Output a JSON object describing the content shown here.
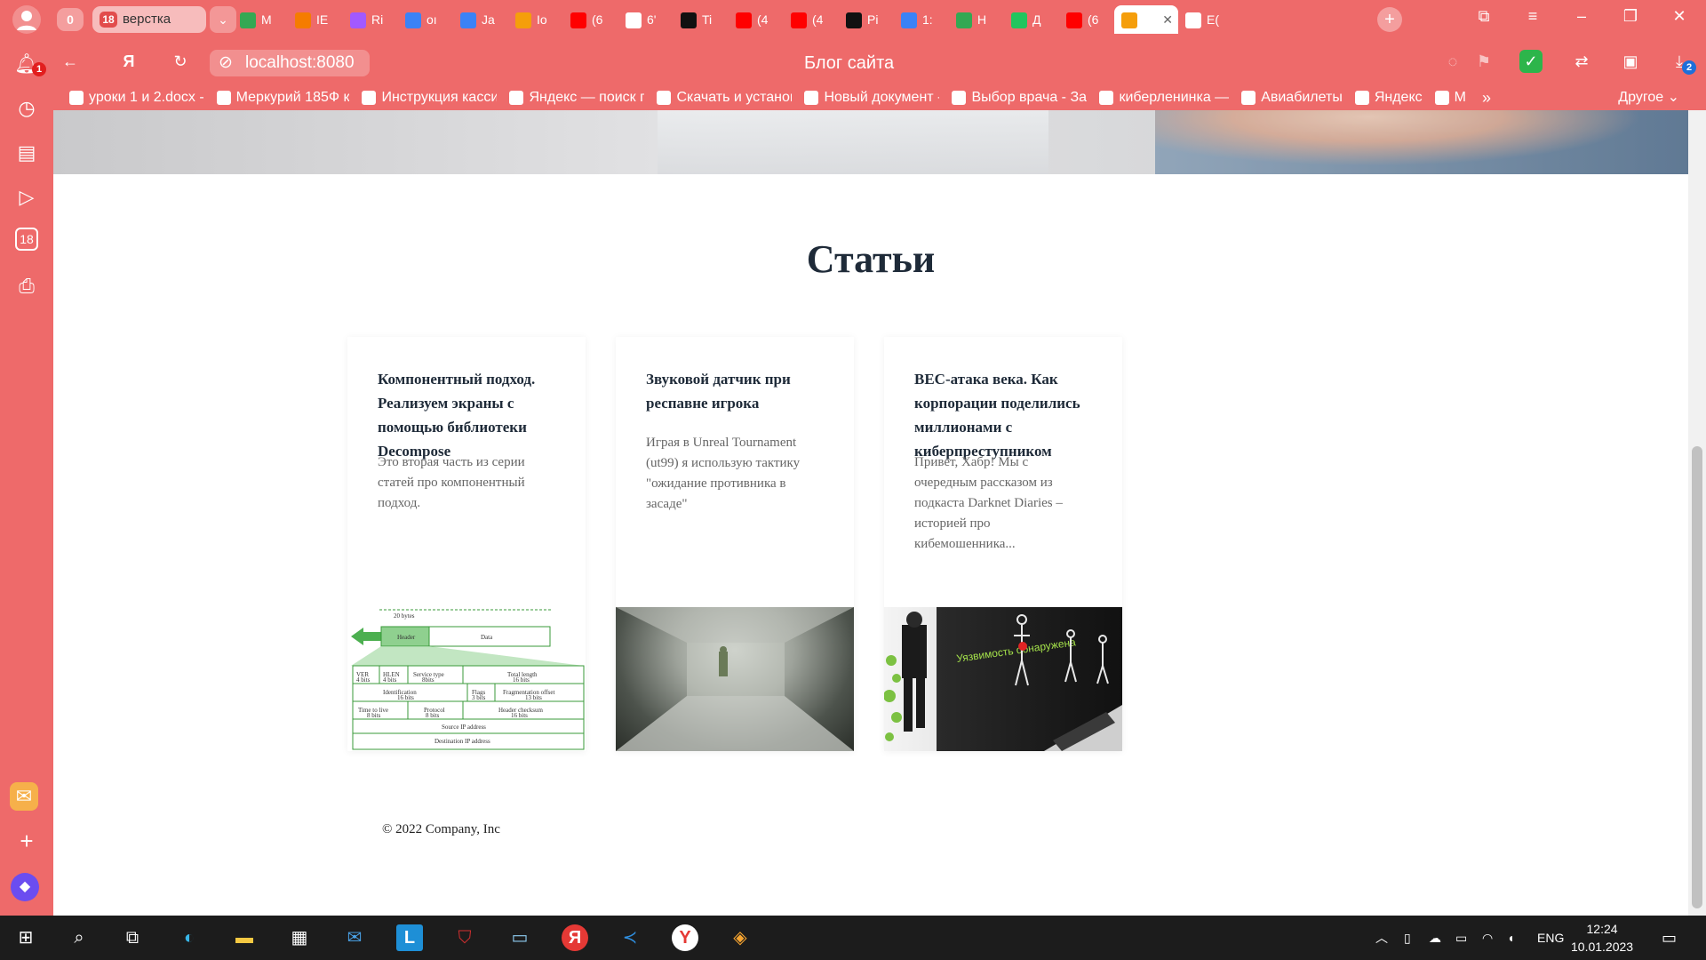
{
  "browser": {
    "tab_count": "0",
    "group_number": "18",
    "group_label": "верстка",
    "tabs": [
      {
        "letter": "M",
        "color": "#34a853",
        "icon": "drive-icon"
      },
      {
        "letter": "IE",
        "color": "#f57c00",
        "icon": "apps-icon"
      },
      {
        "letter": "Ri",
        "color": "#a259ff",
        "icon": "figma-icon"
      },
      {
        "letter": "oı",
        "color": "#3b82f6",
        "icon": "cube-icon"
      },
      {
        "letter": "Ja",
        "color": "#3b82f6",
        "icon": "cube-icon"
      },
      {
        "letter": "Io",
        "color": "#f59e0b",
        "icon": "triangle-icon"
      },
      {
        "letter": "(6",
        "color": "#ff0000",
        "icon": "youtube-icon"
      },
      {
        "letter": "6'",
        "color": "#ffffff",
        "icon": "doc-icon"
      },
      {
        "letter": "Ti",
        "color": "#111111",
        "icon": "z-icon"
      },
      {
        "letter": "(4",
        "color": "#ff0000",
        "icon": "youtube-icon"
      },
      {
        "letter": "(4",
        "color": "#ff0000",
        "icon": "youtube-icon"
      },
      {
        "letter": "Pi",
        "color": "#111111",
        "icon": "m-icon"
      },
      {
        "letter": "1:",
        "color": "#3b82f6",
        "icon": "r-icon"
      },
      {
        "letter": "H",
        "color": "#34a853",
        "icon": "drive-icon"
      },
      {
        "letter": "Д",
        "color": "#22c55e",
        "icon": "hd-icon"
      },
      {
        "letter": "(6",
        "color": "#ff0000",
        "icon": "youtube-icon"
      },
      {
        "letter": "",
        "color": "#f59e0b",
        "icon": "xampp-icon",
        "active": true
      },
      {
        "letter": "E(",
        "color": "#ffffff",
        "icon": "github-icon"
      }
    ],
    "url": "localhost:8080",
    "page_title": "Блог сайта",
    "notification_count": "1",
    "downloads_count": "2",
    "bookmarks": [
      {
        "label": "уроки 1 и 2.docx -",
        "icon": "docs-icon"
      },
      {
        "label": "Меркурий 185Ф к",
        "icon": "green-circle-icon"
      },
      {
        "label": "Инструкция касси",
        "icon": "purple-icon"
      },
      {
        "label": "Яндекс — поиск по",
        "icon": "yandex-icon"
      },
      {
        "label": "Скачать и установ",
        "icon": "yandex-browser-icon"
      },
      {
        "label": "Новый документ -",
        "icon": "docs-icon"
      },
      {
        "label": "Выбор врача - Зап",
        "icon": "medical-icon"
      },
      {
        "label": "киберленинка —",
        "icon": "yandex-icon"
      },
      {
        "label": "Авиабилеты",
        "icon": "plane-icon"
      },
      {
        "label": "Яндекс",
        "icon": "yandex-icon"
      },
      {
        "label": "M",
        "icon": "mail-icon"
      }
    ],
    "bookmarks_more": "»",
    "other_label": "Другое"
  },
  "page": {
    "section_title": "Статьи",
    "articles": [
      {
        "title": "Компонентный подход. Реализуем экраны с помощью библиотеки Decompose",
        "excerpt": "Это вторая часть из серии статей про компонентный подход.",
        "image": "ip-header-diagram"
      },
      {
        "title": "Звуковой датчик при респавне игрока",
        "excerpt": "Играя в Unreal Tournament (ut99) я использую тактику \"ожидание противника в засаде\"",
        "image": "game-screenshot"
      },
      {
        "title": "BEC-атака века. Как корпорации поделились миллионами с киберпреступником",
        "excerpt": "Привет, Хабр! Мы с очередным рассказом из подкаста Darknet Diaries – историей про кибемошенника...",
        "image": "vulnerability-illustration"
      }
    ],
    "diagram": {
      "size": "20 bytes",
      "header": "Header",
      "data": "Data",
      "row1": [
        "VER\n4 bits",
        "HLEN\n4 bits",
        "Service type\n8bits",
        "Total length\n16 bits"
      ],
      "row2": [
        "Identification\n16 bits",
        "Flags\n3 bits",
        "Fragmentation offset\n13 bits"
      ],
      "row3": [
        "Time to live\n8 bits",
        "Protocol\n8 bits",
        "Header checksum\n16 bits"
      ],
      "row4": "Source IP address",
      "row5": "Destination IP address"
    },
    "art_caption": "Уязвимость обнаружена",
    "footer": "© 2022 Company, Inc"
  },
  "taskbar": {
    "language": "ENG",
    "time": "12:24",
    "date": "10.01.2023"
  }
}
